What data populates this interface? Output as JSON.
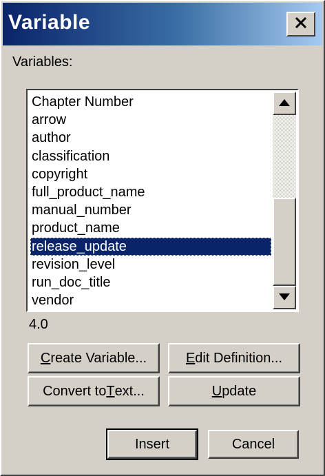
{
  "window": {
    "title": "Variable"
  },
  "variables_label": "Variables:",
  "variables": [
    {
      "label": "Chapter Number"
    },
    {
      "label": "arrow"
    },
    {
      "label": "author"
    },
    {
      "label": "classification"
    },
    {
      "label": "copyright"
    },
    {
      "label": "full_product_name"
    },
    {
      "label": "manual_number"
    },
    {
      "label": "product_name"
    },
    {
      "label": "release_update",
      "selected": true
    },
    {
      "label": "revision_level"
    },
    {
      "label": "run_doc_title"
    },
    {
      "label": "vendor"
    }
  ],
  "selected_value": "4.0",
  "buttons": {
    "create_variable": {
      "pre": "",
      "mnemonic": "C",
      "post": "reate Variable..."
    },
    "edit_definition": {
      "pre": "",
      "mnemonic": "E",
      "post": "dit Definition..."
    },
    "convert_to_text": {
      "pre": "Convert to ",
      "mnemonic": "T",
      "post": "ext..."
    },
    "update": {
      "pre": "",
      "mnemonic": "U",
      "post": "pdate"
    },
    "insert": {
      "pre": "Insert",
      "mnemonic": "",
      "post": ""
    },
    "cancel": {
      "pre": "Cancel",
      "mnemonic": "",
      "post": ""
    }
  },
  "colors": {
    "title_gradient_start": "#0a246a",
    "title_gradient_end": "#a6caf0",
    "selection": "#0a246a",
    "face": "#d4d0c8"
  },
  "icons": {
    "close": "close-icon",
    "scroll_up": "triangle-up-icon",
    "scroll_down": "triangle-down-icon"
  }
}
